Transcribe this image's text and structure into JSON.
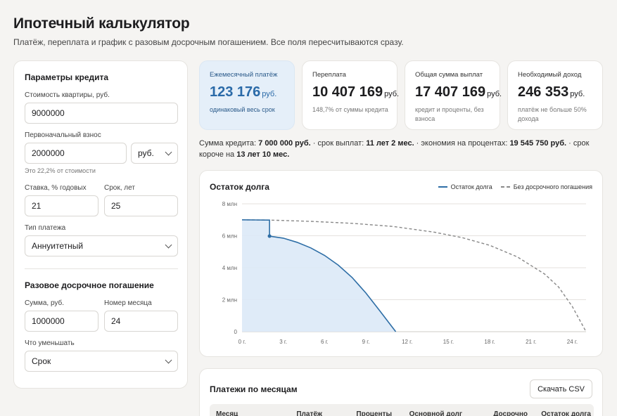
{
  "header": {
    "title": "Ипотечный калькулятор",
    "subtitle": "Платёж, переплата и график с разовым досрочным погашением. Все поля пересчитываются сразу."
  },
  "params": {
    "title": "Параметры кредита",
    "price_label": "Стоимость квартиры, руб.",
    "price_value": "9000000",
    "down_label": "Первоначальный взнос",
    "down_value": "2000000",
    "down_unit": "руб.",
    "down_hint": "Это 22,2% от стоимости",
    "rate_label": "Ставка, % годовых",
    "rate_value": "21",
    "term_label": "Срок, лет",
    "term_value": "25",
    "type_label": "Тип платежа",
    "type_value": "Аннуитетный",
    "prepay_title": "Разовое досрочное погашение",
    "prepay_sum_label": "Сумма, руб.",
    "prepay_sum_value": "1000000",
    "prepay_month_label": "Номер месяца",
    "prepay_month_value": "24",
    "reduce_label": "Что уменьшать",
    "reduce_value": "Срок"
  },
  "stats": [
    {
      "label": "Ежемесячный платёж",
      "value": "123 176",
      "unit": "руб.",
      "note": "одинаковый весь срок"
    },
    {
      "label": "Переплата",
      "value": "10 407 169",
      "unit": "руб.",
      "note": "148,7% от суммы кредита"
    },
    {
      "label": "Общая сумма выплат",
      "value": "17 407 169",
      "unit": "руб.",
      "note": "кредит и проценты, без взноса"
    },
    {
      "label": "Необходимый доход",
      "value": "246 353",
      "unit": "руб.",
      "note": "платёж не больше 50% дохода"
    }
  ],
  "summary": {
    "p1": "Сумма кредита: ",
    "b1": "7 000 000 руб.",
    "p2": " · срок выплат: ",
    "b2": "11 лет 2 мес.",
    "p3": " · экономия на процентах: ",
    "b3": "19 545 750 руб.",
    "p4": " · срок короче на ",
    "b4": "13 лет 10 мес."
  },
  "chart": {
    "title": "Остаток долга",
    "legend_debt": "Остаток долга",
    "legend_no_prepay": "Без досрочного погашения",
    "colors": {
      "debt": "#2e6ea6",
      "fill": "#dbe9f7",
      "baseline": "#888888",
      "grid": "#e4e2de"
    }
  },
  "chart_data": {
    "type": "line",
    "title": "Остаток долга",
    "x_ticks": [
      "0 г.",
      "3 г.",
      "6 г.",
      "9 г.",
      "12 г.",
      "15 г.",
      "18 г.",
      "21 г.",
      "24 г."
    ],
    "y_ticks": [
      "0",
      "2 млн",
      "4 млн",
      "6 млн",
      "8 млн"
    ],
    "xlim": [
      0,
      25
    ],
    "ylim": [
      0,
      8000000
    ],
    "grid": true,
    "legend": "top-right",
    "series": [
      {
        "name": "Остаток долга",
        "style": "solid",
        "x": [
          0,
          1,
          2,
          2,
          3,
          4,
          5,
          6,
          7,
          8,
          9,
          10,
          11.17
        ],
        "y": [
          7000000,
          6990000,
          6980000,
          5980000,
          5850000,
          5590000,
          5240000,
          4770000,
          4160000,
          3390000,
          2420000,
          1320000,
          0
        ],
        "marker_at_x": 2
      },
      {
        "name": "Без досрочного погашения",
        "style": "dashed",
        "x": [
          0,
          2,
          5,
          8,
          11,
          14,
          16,
          18,
          20,
          22,
          23,
          24,
          25
        ],
        "y": [
          7000000,
          6980000,
          6900000,
          6780000,
          6580000,
          6220000,
          5880000,
          5400000,
          4680000,
          3600000,
          2800000,
          1580000,
          0
        ]
      }
    ]
  },
  "table": {
    "title": "Платежи по месяцам",
    "csv_label": "Скачать CSV",
    "columns": [
      "Месяц",
      "Платёж",
      "Проценты",
      "Основной долг",
      "Досрочно",
      "Остаток долга"
    ]
  }
}
